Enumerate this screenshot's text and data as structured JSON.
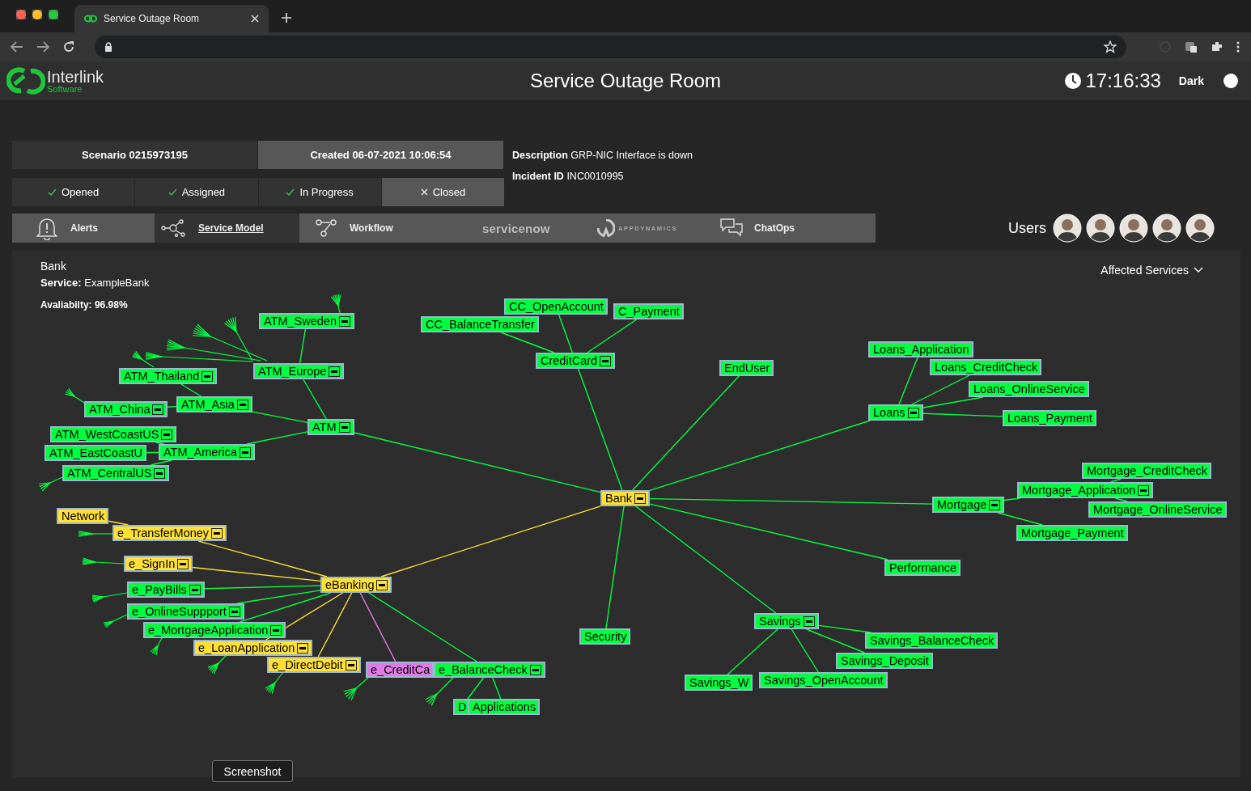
{
  "browser": {
    "tab_title": "Service Outage Room"
  },
  "header": {
    "logo_name": "Interlink",
    "logo_sub": "Software",
    "title": "Service Outage Room",
    "clock": "17:16:33",
    "theme_label": "Dark"
  },
  "incident": {
    "scenario": "Scenario  0215973195",
    "created": "Created  06-07-2021 10:06:54",
    "description": "**Description**  GRP-NIC Interface is down",
    "incident_id": "**Incident ID**  INC0010995"
  },
  "statuses": [
    {
      "label": "Opened",
      "done": true,
      "selected": false
    },
    {
      "label": "Assigned",
      "done": true,
      "selected": false
    },
    {
      "label": "In Progress",
      "done": true,
      "selected": false
    },
    {
      "label": "Closed",
      "done": false,
      "selected": true
    }
  ],
  "tools": [
    {
      "label": "Alerts",
      "kind": "alerts",
      "selected": false
    },
    {
      "label": "Service Model",
      "kind": "model",
      "selected": true
    },
    {
      "label": "Workflow",
      "kind": "workflow",
      "selected": false
    },
    {
      "label": "servicenow",
      "kind": "servicenow",
      "selected": false
    },
    {
      "label": "APPDYNAMICS",
      "kind": "appdynamics",
      "selected": false
    },
    {
      "label": "ChatOps",
      "kind": "chatops",
      "selected": false
    }
  ],
  "users": {
    "label": "Users",
    "people": [
      {
        "kind": "avatar"
      },
      {
        "kind": "avatar"
      },
      {
        "kind": "avatar"
      },
      {
        "kind": "avatar"
      },
      {
        "kind": "avatar"
      }
    ]
  },
  "panel": {
    "title": "Bank",
    "service": "**Service:** ExampleBank",
    "availability": "Avaliabilty: 96.98%",
    "filter": "Affected Services"
  },
  "graph": {
    "root": {
      "label": "Bank",
      "kind": "group",
      "color": "#ffe033",
      "children": [
        {
          "label": "ATM",
          "kind": "group",
          "color": "#00ff40",
          "children": [
            {
              "label": "ATM_Europe",
              "kind": "group",
              "color": "#00ff40",
              "children": [
                {
                  "label": "ATM_Sweden",
                  "kind": "group",
                  "color": "#00ff40"
                }
              ]
            },
            {
              "label": "ATM_Asia",
              "kind": "group",
              "color": "#00ff40",
              "children": [
                {
                  "label": "ATM_Thailand",
                  "kind": "group",
                  "color": "#00ff40"
                },
                {
                  "label": "ATM_China",
                  "kind": "group",
                  "color": "#00ff40"
                }
              ]
            },
            {
              "label": "ATM_America",
              "kind": "group",
              "color": "#00ff40",
              "children": [
                {
                  "label": "ATM_WestCoastUS",
                  "kind": "group",
                  "color": "#00ff40"
                },
                {
                  "label": "ATM_EastCoastU",
                  "kind": "leaf",
                  "color": "#00ff40"
                },
                {
                  "label": "ATM_CentralUS",
                  "kind": "group",
                  "color": "#00ff40"
                }
              ]
            }
          ]
        },
        {
          "label": "CreditCard",
          "kind": "group",
          "color": "#00ff40",
          "children": [
            {
              "label": "CC_BalanceTransfer",
              "kind": "leaf",
              "color": "#00ff40"
            },
            {
              "label": "CC_OpenAccount",
              "kind": "leaf",
              "color": "#00ff40"
            },
            {
              "label": "C_Payment",
              "kind": "leaf",
              "color": "#00ff40"
            }
          ]
        },
        {
          "label": "EndUser",
          "kind": "leaf",
          "color": "#00ff40"
        },
        {
          "label": "Loans",
          "kind": "group",
          "color": "#00ff40",
          "children": [
            {
              "label": "Loans_Application",
              "kind": "leaf",
              "color": "#00ff40"
            },
            {
              "label": "Loans_CreditCheck",
              "kind": "leaf",
              "color": "#00ff40"
            },
            {
              "label": "Loans_OnlineService",
              "kind": "leaf",
              "color": "#00ff40"
            },
            {
              "label": "Loans_Payment",
              "kind": "leaf",
              "color": "#00ff40"
            }
          ]
        },
        {
          "label": "Mortgage",
          "kind": "group",
          "color": "#00ff40",
          "children": [
            {
              "label": "Mortgage_Application",
              "kind": "group",
              "color": "#00ff40",
              "children": [
                {
                  "label": "Mortgage_CreditCheck",
                  "kind": "leaf",
                  "color": "#00ff40"
                },
                {
                  "label": "Mortgage_OnlineService",
                  "kind": "leaf",
                  "color": "#00ff40"
                }
              ]
            },
            {
              "label": "Mortgage_Payment",
              "kind": "leaf",
              "color": "#00ff40"
            }
          ]
        },
        {
          "label": "Performance",
          "kind": "leaf",
          "color": "#00ff40"
        },
        {
          "label": "Savings",
          "kind": "group",
          "color": "#00ff40",
          "children": [
            {
              "label": "Savings_BalanceCheck",
              "kind": "leaf",
              "color": "#00ff40"
            },
            {
              "label": "Savings_Deposit",
              "kind": "leaf",
              "color": "#00ff40"
            },
            {
              "label": "Savings_W",
              "kind": "leaf",
              "color": "#00ff40"
            },
            {
              "label": "Savings_OpenAccount",
              "kind": "leaf",
              "color": "#00ff40"
            }
          ]
        },
        {
          "label": "Security",
          "kind": "leaf",
          "color": "#00ff40"
        },
        {
          "label": "eBanking",
          "kind": "group",
          "color": "#ffe033",
          "children": [
            {
              "label": "e_TransferMoney",
              "kind": "group",
              "color": "#ffe033",
              "children": [
                {
                  "label": "Network",
                  "kind": "leaf",
                  "color": "#ffe033"
                }
              ]
            },
            {
              "label": "e_SignIn",
              "kind": "group",
              "color": "#ffe033"
            },
            {
              "label": "e_PayBills",
              "kind": "group",
              "color": "#00ff40"
            },
            {
              "label": "e_OnlineSuppport",
              "kind": "group",
              "color": "#00ff40"
            },
            {
              "label": "e_MortgageApplication",
              "kind": "group",
              "color": "#00ff40"
            },
            {
              "label": "e_LoanApplication",
              "kind": "group",
              "color": "#ffe033"
            },
            {
              "label": "e_DirectDebit",
              "kind": "group",
              "color": "#ffe033"
            },
            {
              "label": "e_CreditCa",
              "kind": "leaf",
              "color": "#e27ae6"
            },
            {
              "label": "e_BalanceCheck",
              "kind": "group",
              "color": "#00ff40",
              "children": [
                {
                  "label": "D",
                  "kind": "leaf",
                  "color": "#00ff40"
                },
                {
                  "label": "Applications",
                  "kind": "leaf",
                  "color": "#00ff40"
                }
              ]
            }
          ]
        }
      ]
    }
  },
  "tooltip": "Screenshot"
}
